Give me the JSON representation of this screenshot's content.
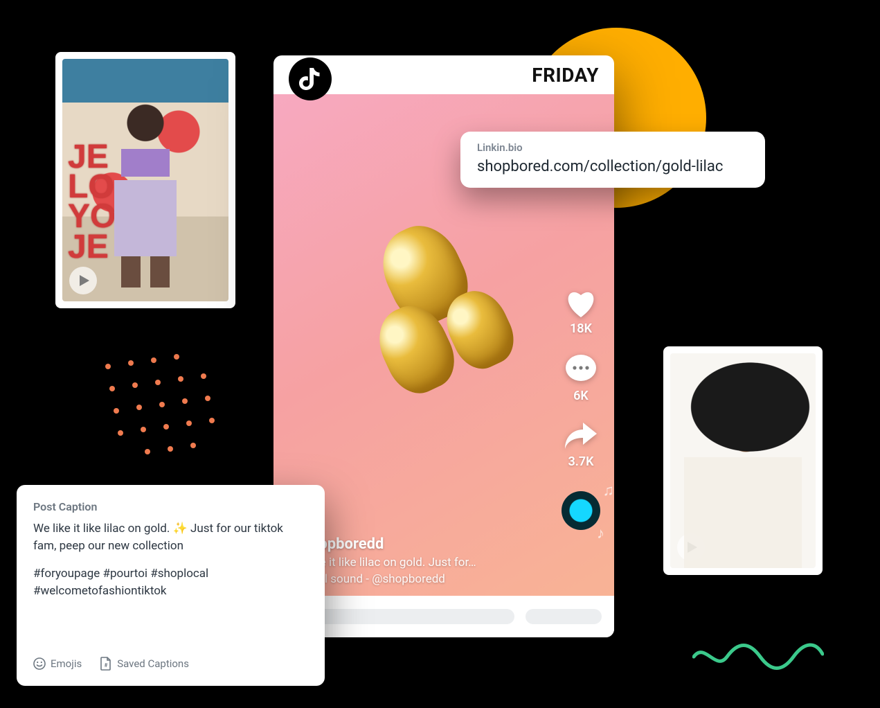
{
  "thumb_left": {
    "bg_text": "JE\nLO\nYO\nJE"
  },
  "tiktok": {
    "day": "FRIDAY",
    "likes": "18K",
    "comments": "6K",
    "shares": "3.7K",
    "handle": "@shopboredd",
    "caption_trunc": "We like it like lilac on gold. Just for…",
    "sound": "original sound - @shopboredd"
  },
  "linkin": {
    "label": "Linkin.bio",
    "url": "shopbored.com/collection/gold-lilac"
  },
  "composer": {
    "title": "Post Caption",
    "caption": "We like it like lilac on gold. ✨ Just for our tiktok fam, peep our new collection",
    "hashtags": "#foryoupage #pourtoi #shoplocal #welcometofashiontiktok",
    "tool_emojis": "Emojis",
    "tool_saved": "Saved Captions"
  }
}
